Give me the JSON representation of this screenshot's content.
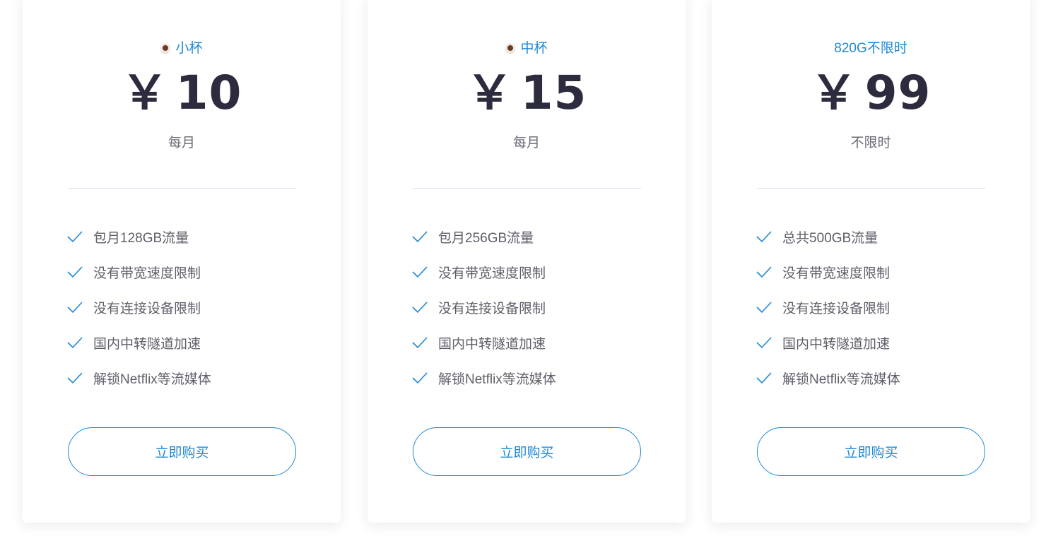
{
  "plans": [
    {
      "name": "小杯",
      "icon": "coffee-icon",
      "currency": "￥",
      "price": "10",
      "period": "每月",
      "features": [
        "包月128GB流量",
        "没有带宽速度限制",
        "没有连接设备限制",
        "国内中转隧道加速",
        "解锁Netflix等流媒体"
      ],
      "button_label": "立即购买"
    },
    {
      "name": "中杯",
      "icon": "coffee-icon",
      "currency": "￥",
      "price": "15",
      "period": "每月",
      "features": [
        "包月256GB流量",
        "没有带宽速度限制",
        "没有连接设备限制",
        "国内中转隧道加速",
        "解锁Netflix等流媒体"
      ],
      "button_label": "立即购买"
    },
    {
      "name": "820G不限时",
      "icon": null,
      "currency": "￥",
      "price": "99",
      "period": "不限时",
      "features": [
        "总共500GB流量",
        "没有带宽速度限制",
        "没有连接设备限制",
        "国内中转隧道加速",
        "解锁Netflix等流媒体"
      ],
      "button_label": "立即购买"
    }
  ],
  "colors": {
    "accent": "#1e88d6",
    "price_text": "#2c2c3e",
    "muted_text": "#6b6b76",
    "divider": "#d7dcea"
  }
}
